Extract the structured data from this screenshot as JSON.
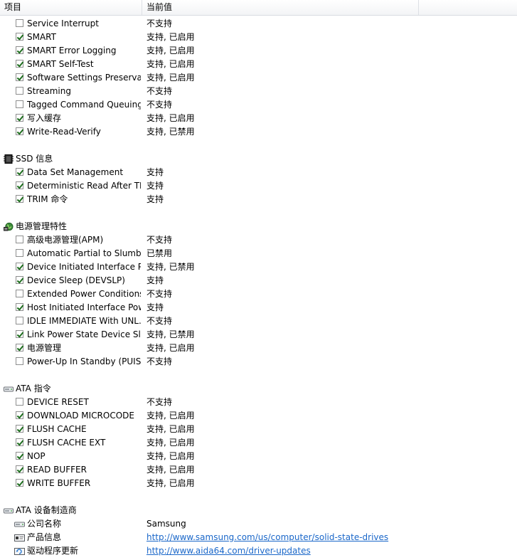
{
  "header": {
    "col1": "项目",
    "col2": "当前值"
  },
  "features": [
    {
      "label": "Service Interrupt",
      "value": "不支持",
      "checked": false
    },
    {
      "label": "SMART",
      "value": "支持, 已启用",
      "checked": true
    },
    {
      "label": "SMART Error Logging",
      "value": "支持, 已启用",
      "checked": true
    },
    {
      "label": "SMART Self-Test",
      "value": "支持, 已启用",
      "checked": true
    },
    {
      "label": "Software Settings Preservati...",
      "value": "支持, 已启用",
      "checked": true
    },
    {
      "label": "Streaming",
      "value": "不支持",
      "checked": false
    },
    {
      "label": "Tagged Command Queuing...",
      "value": "不支持",
      "checked": false
    },
    {
      "label": "写入缓存",
      "value": "支持, 已启用",
      "checked": true
    },
    {
      "label": "Write-Read-Verify",
      "value": "支持, 已禁用",
      "checked": true
    }
  ],
  "ssd": {
    "title": "SSD 信息",
    "items": [
      {
        "label": "Data Set Management",
        "value": "支持",
        "checked": true
      },
      {
        "label": "Deterministic Read After TRIM",
        "value": "支持",
        "checked": true
      },
      {
        "label": "TRIM 命令",
        "value": "支持",
        "checked": true
      }
    ]
  },
  "power": {
    "title": "电源管理特性",
    "items": [
      {
        "label": "高级电源管理(APM)",
        "value": "不支持",
        "checked": false
      },
      {
        "label": "Automatic Partial to Slumbe...",
        "value": "已禁用",
        "checked": false
      },
      {
        "label": "Device Initiated Interface Po...",
        "value": "支持, 已禁用",
        "checked": true
      },
      {
        "label": "Device Sleep (DEVSLP)",
        "value": "支持",
        "checked": true
      },
      {
        "label": "Extended Power Conditions ...",
        "value": "不支持",
        "checked": false
      },
      {
        "label": "Host Initiated Interface Pow...",
        "value": "支持",
        "checked": true
      },
      {
        "label": "IDLE IMMEDIATE With UNL...",
        "value": "不支持",
        "checked": false
      },
      {
        "label": "Link Power State Device Sleep",
        "value": "支持, 已禁用",
        "checked": true
      },
      {
        "label": "电源管理",
        "value": "支持, 已启用",
        "checked": true
      },
      {
        "label": "Power-Up In Standby (PUIS)",
        "value": "不支持",
        "checked": false
      }
    ]
  },
  "ata_commands": {
    "title": "ATA 指令",
    "items": [
      {
        "label": "DEVICE RESET",
        "value": "不支持",
        "checked": false
      },
      {
        "label": "DOWNLOAD MICROCODE",
        "value": "支持, 已启用",
        "checked": true
      },
      {
        "label": "FLUSH CACHE",
        "value": "支持, 已启用",
        "checked": true
      },
      {
        "label": "FLUSH CACHE EXT",
        "value": "支持, 已启用",
        "checked": true
      },
      {
        "label": "NOP",
        "value": "支持, 已启用",
        "checked": true
      },
      {
        "label": "READ BUFFER",
        "value": "支持, 已启用",
        "checked": true
      },
      {
        "label": "WRITE BUFFER",
        "value": "支持, 已启用",
        "checked": true
      }
    ]
  },
  "manufacturer": {
    "title": "ATA 设备制造商",
    "company_label": "公司名称",
    "company_value": "Samsung",
    "product_label": "产品信息",
    "product_url": "http://www.samsung.com/us/computer/solid-state-drives",
    "driver_label": "驱动程序更新",
    "driver_url": "http://www.aida64.com/driver-updates"
  },
  "colors": {
    "link": "#1a67c9",
    "check": "#1e6e1e"
  },
  "icons": {
    "ssd": "ssd-chip-icon",
    "power": "power-globe-icon",
    "ata": "drive-icon",
    "company": "drive-small-icon",
    "product": "info-card-icon",
    "driver": "update-icon"
  }
}
